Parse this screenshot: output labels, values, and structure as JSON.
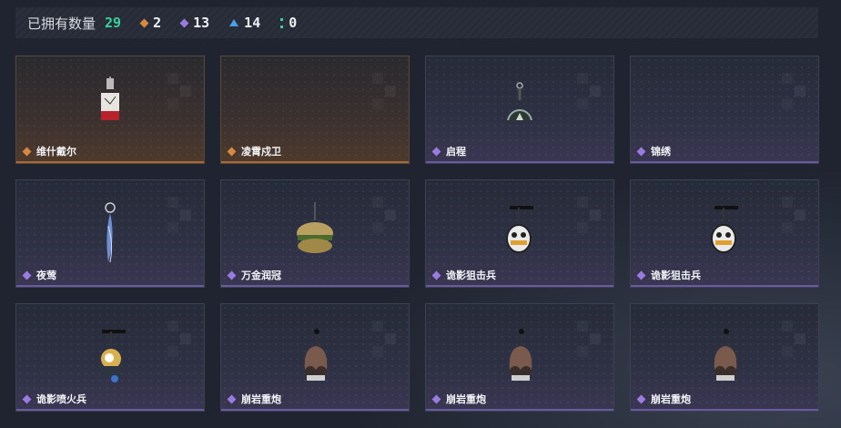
{
  "header": {
    "owned_label": "已拥有数量",
    "owned_total": "29",
    "stats": [
      {
        "icon": "orange-diamond-icon",
        "value": "2",
        "color": "#d9883f"
      },
      {
        "icon": "purple-diamond-icon",
        "value": "13",
        "color": "#9a7ce0"
      },
      {
        "icon": "blue-triangle-icon",
        "value": "14",
        "color": "#4aa0e8"
      },
      {
        "icon": "green-dots-icon",
        "value": "0",
        "color": "#35d39a"
      }
    ]
  },
  "items": [
    {
      "name": "维什戴尔",
      "rarity": "orange",
      "art": "red-charm-icon"
    },
    {
      "name": "凌霄戍卫",
      "rarity": "orange",
      "art": "none"
    },
    {
      "name": "启程",
      "rarity": "purple",
      "art": "medal-charm-icon"
    },
    {
      "name": "锦绣",
      "rarity": "purple",
      "art": "none"
    },
    {
      "name": "夜莺",
      "rarity": "purple",
      "art": "feather-charm-icon"
    },
    {
      "name": "万金润冠",
      "rarity": "purple",
      "art": "burger-charm-icon"
    },
    {
      "name": "诡影狙击兵",
      "rarity": "purple",
      "art": "sniper-charm-icon"
    },
    {
      "name": "诡影狙击兵",
      "rarity": "purple",
      "art": "sniper-charm-icon"
    },
    {
      "name": "诡影喷火兵",
      "rarity": "purple",
      "art": "flamer-charm-icon"
    },
    {
      "name": "崩岩重炮",
      "rarity": "purple",
      "art": "rock-charm-icon"
    },
    {
      "name": "崩岩重炮",
      "rarity": "purple",
      "art": "rock-charm-icon"
    },
    {
      "name": "崩岩重炮",
      "rarity": "purple",
      "art": "rock-charm-icon"
    }
  ]
}
